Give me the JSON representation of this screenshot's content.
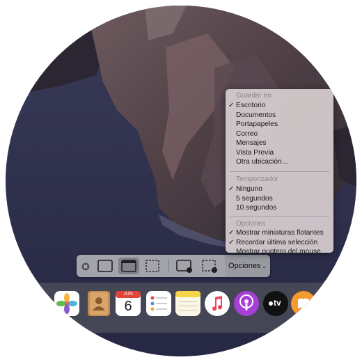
{
  "toolbar": {
    "options_label": "Opciones",
    "buttons": [
      {
        "icon": "close-icon"
      },
      {
        "icon": "capture-entire-screen-icon"
      },
      {
        "icon": "capture-window-icon",
        "selected": true
      },
      {
        "icon": "capture-selection-icon"
      },
      {
        "icon": "record-entire-screen-icon"
      },
      {
        "icon": "record-selection-icon"
      }
    ]
  },
  "menu": {
    "save_to": {
      "header": "Guardar en",
      "items": [
        {
          "label": "Escritorio",
          "checked": true
        },
        {
          "label": "Documentos",
          "checked": false
        },
        {
          "label": "Portapapeles",
          "checked": false
        },
        {
          "label": "Correo",
          "checked": false
        },
        {
          "label": "Mensajes",
          "checked": false
        },
        {
          "label": "Vista Previa",
          "checked": false
        },
        {
          "label": "Otra ubicación...",
          "checked": false
        }
      ]
    },
    "timer": {
      "header": "Temporizador",
      "items": [
        {
          "label": "Ninguno",
          "checked": true
        },
        {
          "label": "5 segundos",
          "checked": false
        },
        {
          "label": "10 segundos",
          "checked": false
        }
      ]
    },
    "options": {
      "header": "Opciones",
      "items": [
        {
          "label": "Mostrar miniaturas flotantes",
          "checked": true
        },
        {
          "label": "Recordar última selección",
          "checked": true
        },
        {
          "label": "Mostrar puntero del mouse",
          "checked": false
        }
      ]
    },
    "check_glyph": "✓"
  },
  "dock": {
    "calendar_month": "JUN",
    "calendar_day": "6",
    "appletv_label": "tv",
    "apps": [
      "photos-icon",
      "contacts-icon",
      "calendar-icon",
      "reminders-icon",
      "notes-icon",
      "music-icon",
      "podcasts-icon",
      "apple-tv-icon",
      "books-icon"
    ]
  },
  "colors": {
    "menu_bg": "#d6cdd0",
    "toolbar_bg": "#b4b4ba",
    "dock_bg": "#50525c",
    "podcasts": "#a53fd6",
    "notes": "#f7d54a",
    "calendar_red": "#e0443a"
  }
}
